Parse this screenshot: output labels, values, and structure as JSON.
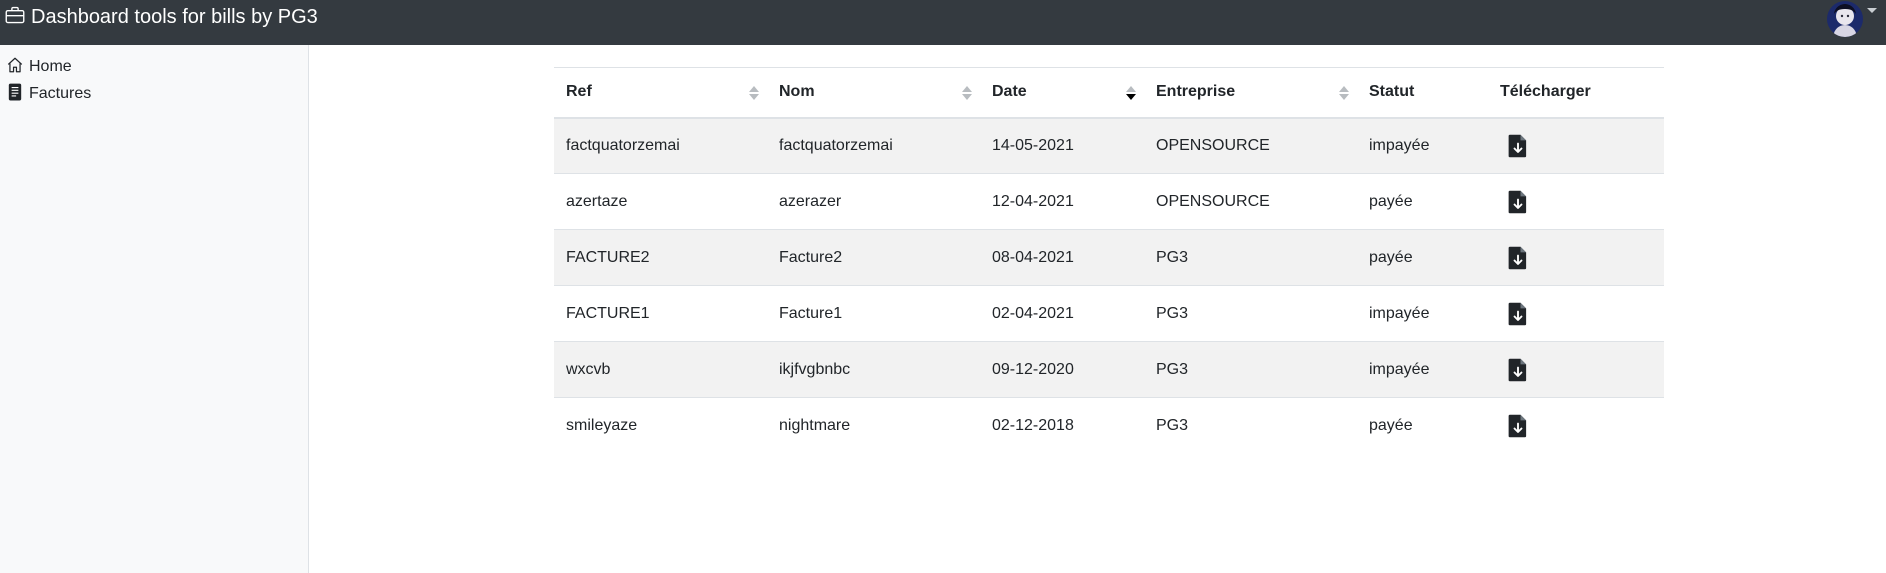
{
  "app": {
    "title": "Dashboard tools for bills by PG3"
  },
  "header": {
    "brand_icon": "briefcase-icon",
    "avatar_icon": "user-avatar",
    "caret_icon": "caret-down-icon"
  },
  "sidebar": {
    "items": [
      {
        "label": "Home",
        "icon": "house-icon"
      },
      {
        "label": "Factures",
        "icon": "file-text-icon"
      }
    ]
  },
  "table": {
    "columns": [
      {
        "label": "Ref",
        "sortable": true,
        "sorted": false
      },
      {
        "label": "Nom",
        "sortable": true,
        "sorted": false
      },
      {
        "label": "Date",
        "sortable": true,
        "sorted": "desc"
      },
      {
        "label": "Entreprise",
        "sortable": true,
        "sorted": false
      },
      {
        "label": "Statut",
        "sortable": false
      },
      {
        "label": "Télécharger",
        "sortable": false
      }
    ],
    "download_icon": "file-download-icon",
    "rows": [
      {
        "ref": "factquatorzemai",
        "nom": "factquatorzemai",
        "date": "14-05-2021",
        "entreprise": "OPENSOURCE",
        "statut": "impayée"
      },
      {
        "ref": "azertaze",
        "nom": "azerazer",
        "date": "12-04-2021",
        "entreprise": "OPENSOURCE",
        "statut": "payée"
      },
      {
        "ref": "FACTURE2",
        "nom": "Facture2",
        "date": "08-04-2021",
        "entreprise": "PG3",
        "statut": "payée"
      },
      {
        "ref": "FACTURE1",
        "nom": "Facture1",
        "date": "02-04-2021",
        "entreprise": "PG3",
        "statut": "impayée"
      },
      {
        "ref": "wxcvb",
        "nom": "ikjfvgbnbc",
        "date": "09-12-2020",
        "entreprise": "PG3",
        "statut": "impayée"
      },
      {
        "ref": "smileyaze",
        "nom": "nightmare",
        "date": "02-12-2018",
        "entreprise": "PG3",
        "statut": "payée"
      }
    ]
  },
  "colors": {
    "navbar": "#343a40",
    "sidebar": "#f8f9fa",
    "stripe": "#f2f2f2",
    "text": "#212529"
  }
}
